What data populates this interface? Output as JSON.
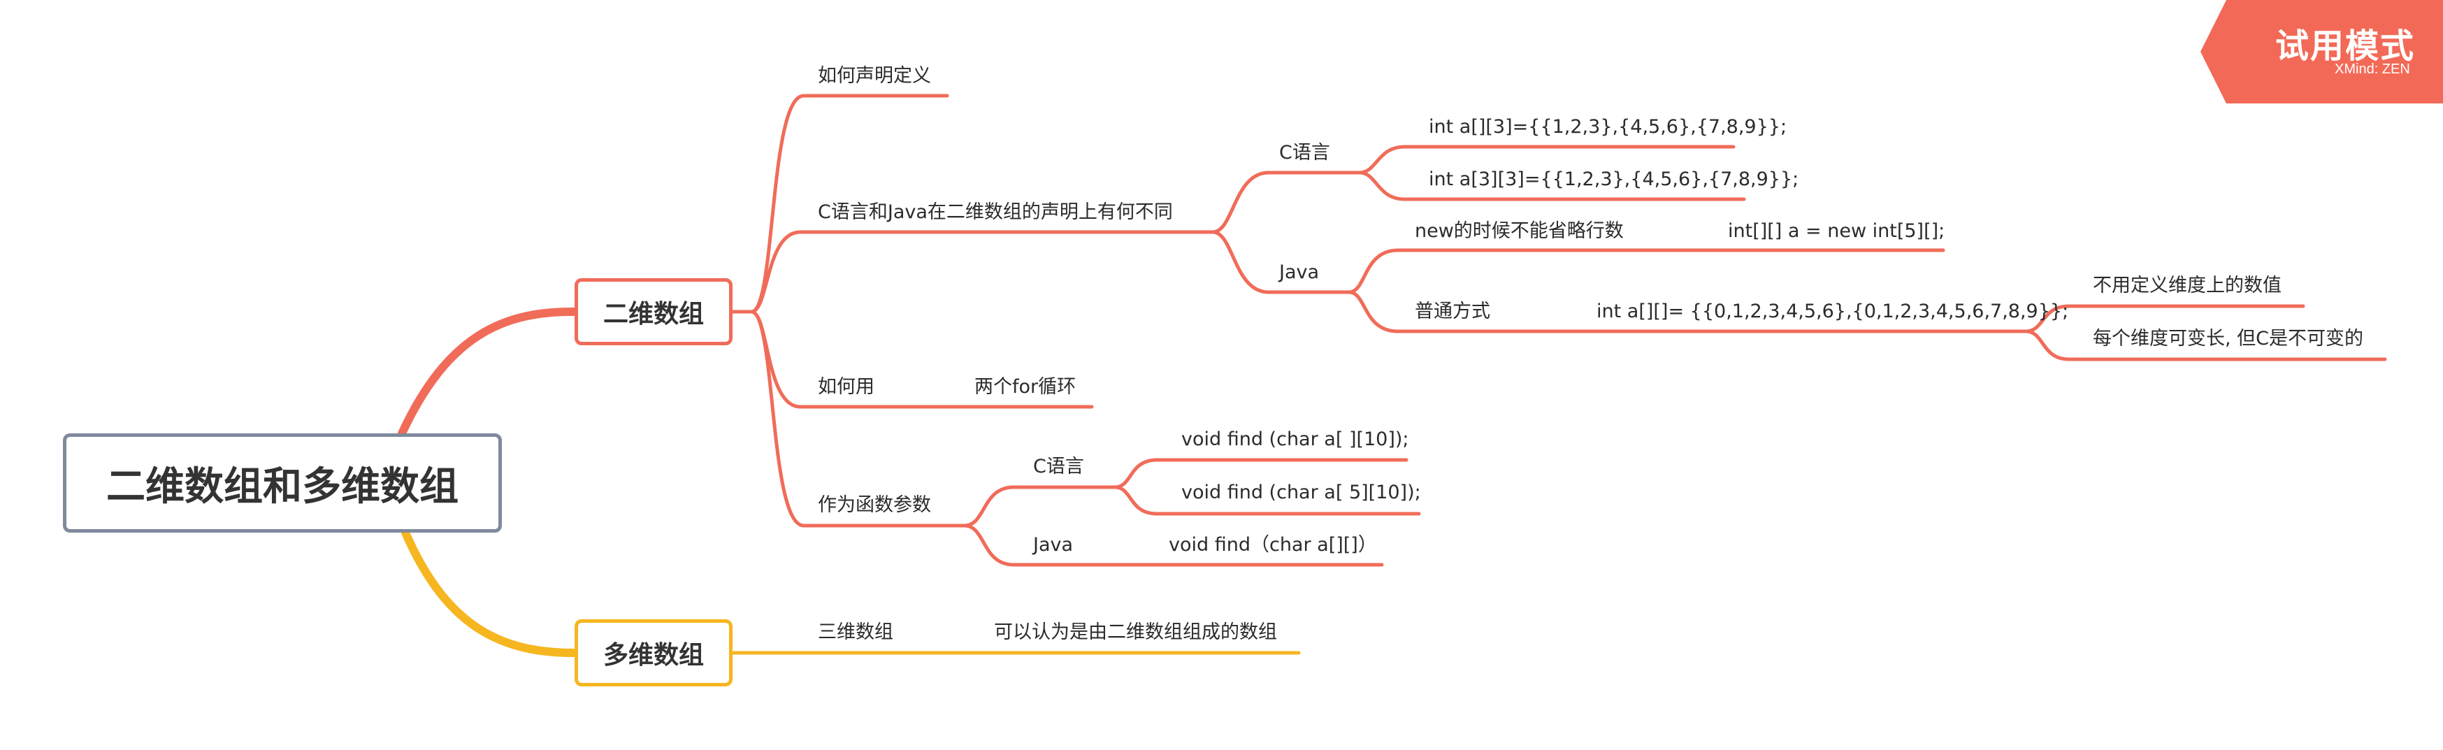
{
  "colors": {
    "branch_primary": "#f06c59",
    "branch_secondary": "#f6b620",
    "root_border": "#7f8a9c",
    "badge_bg": "#f26a57"
  },
  "badge": {
    "title": "试用模式",
    "brand": "XMind: ZEN"
  },
  "root": {
    "label": "二维数组和多维数组"
  },
  "topics": {
    "two_d": {
      "label": "二维数组",
      "declare": "如何声明定义",
      "diff": {
        "label": "C语言和Java在二维数组的声明上有何不同",
        "c": {
          "label": "C语言",
          "ex1": "int a[][3]={{1,2,3},{4,5,6},{7,8,9}};",
          "ex2": "int a[3][3]={{1,2,3},{4,5,6},{7,8,9}};"
        },
        "java": {
          "label": "Java",
          "new_rule": "new的时候不能省略行数",
          "new_example": "int[][] a = new int[5][];",
          "normal": "普通方式",
          "normal_example": "int a[][]= {{0,1,2,3,4,5,6},{0,1,2,3,4,5,6,7,8,9}};",
          "note1": "不用定义维度上的数值",
          "note2": "每个维度可变长, 但C是不可变的"
        }
      },
      "use": {
        "label": "如何用",
        "detail": "两个for循环"
      },
      "param": {
        "label": "作为函数参数",
        "c": {
          "label": "C语言",
          "ex1": "void find (char a[ ][10]);",
          "ex2": "void find (char a[ 5][10]);"
        },
        "java": {
          "label": "Java",
          "ex": "void find（char a[][]）"
        }
      }
    },
    "multi_d": {
      "label": "多维数组",
      "three_d": {
        "label": "三维数组",
        "detail": "可以认为是由二维数组组成的数组"
      }
    }
  }
}
